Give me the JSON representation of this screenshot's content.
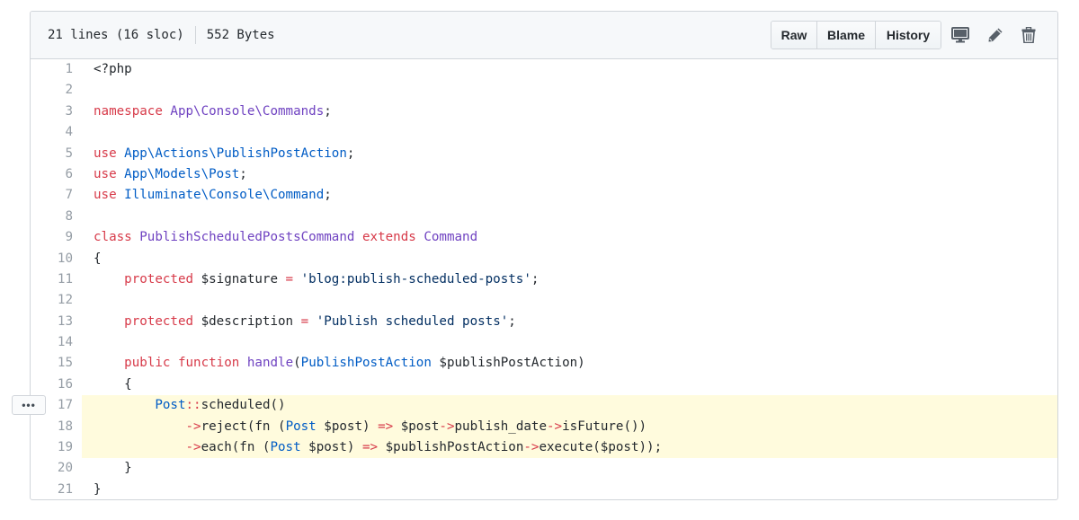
{
  "file_header": {
    "lines": "21 lines (16 sloc)",
    "size": "552 Bytes"
  },
  "buttons": {
    "raw": "Raw",
    "blame": "Blame",
    "history": "History"
  },
  "icons": [
    "desktop-icon",
    "pencil-icon",
    "trash-icon",
    "kebab-horizontal-icon"
  ],
  "more_button": "•••",
  "colors": {
    "keyword": "#d73a49",
    "entity": "#6f42c1",
    "constant": "#005cc5",
    "string": "#032f62",
    "highlight": "#fffbdd"
  },
  "highlighted_lines": [
    17,
    18,
    19
  ],
  "code_lines": [
    [
      [
        "v",
        "<?php"
      ]
    ],
    [],
    [
      [
        "k",
        "namespace"
      ],
      [
        "v",
        " "
      ],
      [
        "e",
        "App\\Console\\Commands"
      ],
      [
        "v",
        ";"
      ]
    ],
    [],
    [
      [
        "k",
        "use"
      ],
      [
        "v",
        " "
      ],
      [
        "c1",
        "App\\Actions\\PublishPostAction"
      ],
      [
        "v",
        ";"
      ]
    ],
    [
      [
        "k",
        "use"
      ],
      [
        "v",
        " "
      ],
      [
        "c1",
        "App\\Models\\Post"
      ],
      [
        "v",
        ";"
      ]
    ],
    [
      [
        "k",
        "use"
      ],
      [
        "v",
        " "
      ],
      [
        "c1",
        "Illuminate\\Console\\Command"
      ],
      [
        "v",
        ";"
      ]
    ],
    [],
    [
      [
        "k",
        "class"
      ],
      [
        "v",
        " "
      ],
      [
        "e",
        "PublishScheduledPostsCommand"
      ],
      [
        "v",
        " "
      ],
      [
        "k",
        "extends"
      ],
      [
        "v",
        " "
      ],
      [
        "e",
        "Command"
      ]
    ],
    [
      [
        "v",
        "{"
      ]
    ],
    [
      [
        "v",
        "    "
      ],
      [
        "k",
        "protected"
      ],
      [
        "v",
        " $signature "
      ],
      [
        "k",
        "="
      ],
      [
        "v",
        " "
      ],
      [
        "s",
        "'blog:publish-scheduled-posts'"
      ],
      [
        "v",
        ";"
      ]
    ],
    [],
    [
      [
        "v",
        "    "
      ],
      [
        "k",
        "protected"
      ],
      [
        "v",
        " $description "
      ],
      [
        "k",
        "="
      ],
      [
        "v",
        " "
      ],
      [
        "s",
        "'Publish scheduled posts'"
      ],
      [
        "v",
        ";"
      ]
    ],
    [],
    [
      [
        "v",
        "    "
      ],
      [
        "k",
        "public"
      ],
      [
        "v",
        " "
      ],
      [
        "k",
        "function"
      ],
      [
        "v",
        " "
      ],
      [
        "e",
        "handle"
      ],
      [
        "v",
        "("
      ],
      [
        "c1",
        "PublishPostAction"
      ],
      [
        "v",
        " $publishPostAction)"
      ]
    ],
    [
      [
        "v",
        "    {"
      ]
    ],
    [
      [
        "v",
        "        "
      ],
      [
        "c1",
        "Post"
      ],
      [
        "k",
        "::"
      ],
      [
        "v",
        "scheduled()"
      ]
    ],
    [
      [
        "v",
        "            "
      ],
      [
        "k",
        "->"
      ],
      [
        "v",
        "reject(fn ("
      ],
      [
        "c1",
        "Post"
      ],
      [
        "v",
        " $post) "
      ],
      [
        "k",
        "=>"
      ],
      [
        "v",
        " $post"
      ],
      [
        "k",
        "->"
      ],
      [
        "v",
        "publish_date"
      ],
      [
        "k",
        "->"
      ],
      [
        "v",
        "isFuture())"
      ]
    ],
    [
      [
        "v",
        "            "
      ],
      [
        "k",
        "->"
      ],
      [
        "v",
        "each(fn ("
      ],
      [
        "c1",
        "Post"
      ],
      [
        "v",
        " $post) "
      ],
      [
        "k",
        "=>"
      ],
      [
        "v",
        " $publishPostAction"
      ],
      [
        "k",
        "->"
      ],
      [
        "v",
        "execute($post));"
      ]
    ],
    [
      [
        "v",
        "    }"
      ]
    ],
    [
      [
        "v",
        "}"
      ]
    ]
  ]
}
